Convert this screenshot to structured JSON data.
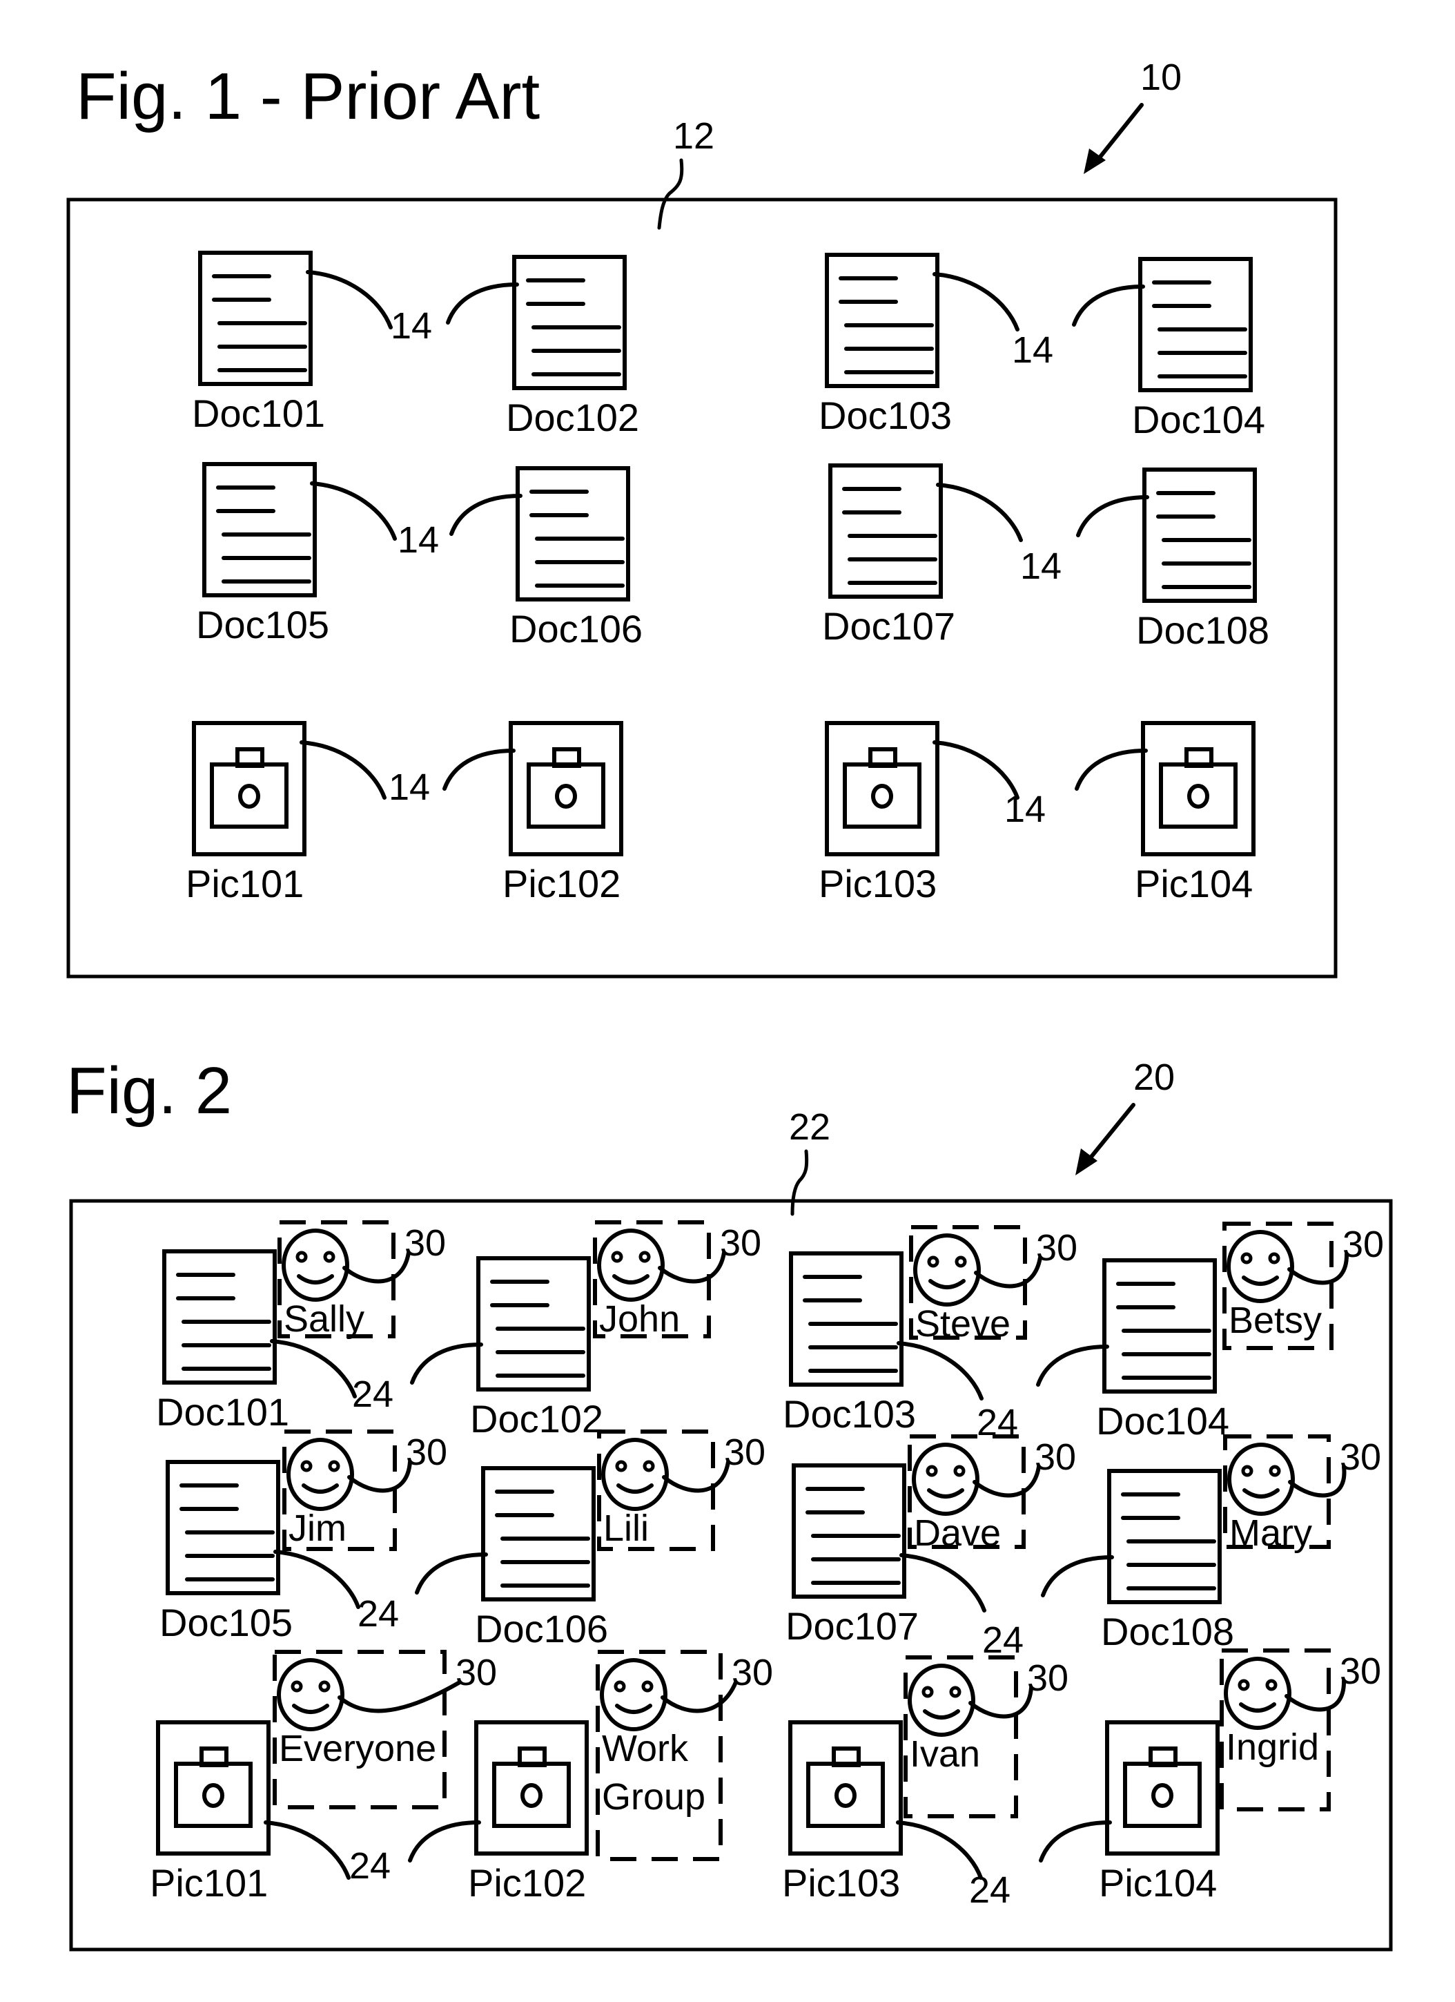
{
  "colors": {
    "ink": "#000000",
    "background": "#ffffff"
  },
  "fig1": {
    "title": "Fig. 1 - Prior Art",
    "ref_system": "10",
    "ref_area": "12",
    "link_ref": "14",
    "items": [
      {
        "label": "Doc101",
        "kind": "document"
      },
      {
        "label": "Doc102",
        "kind": "document"
      },
      {
        "label": "Doc103",
        "kind": "document"
      },
      {
        "label": "Doc104",
        "kind": "document"
      },
      {
        "label": "Doc105",
        "kind": "document"
      },
      {
        "label": "Doc106",
        "kind": "document"
      },
      {
        "label": "Doc107",
        "kind": "document"
      },
      {
        "label": "Doc108",
        "kind": "document"
      },
      {
        "label": "Pic101",
        "kind": "picture"
      },
      {
        "label": "Pic102",
        "kind": "picture"
      },
      {
        "label": "Pic103",
        "kind": "picture"
      },
      {
        "label": "Pic104",
        "kind": "picture"
      }
    ],
    "links": [
      {
        "from": "Doc101",
        "to": "Doc102",
        "ref": "14"
      },
      {
        "from": "Doc103",
        "to": "Doc104",
        "ref": "14"
      },
      {
        "from": "Doc105",
        "to": "Doc106",
        "ref": "14"
      },
      {
        "from": "Doc107",
        "to": "Doc108",
        "ref": "14"
      },
      {
        "from": "Pic101",
        "to": "Pic102",
        "ref": "14"
      },
      {
        "from": "Pic103",
        "to": "Pic104",
        "ref": "14"
      }
    ]
  },
  "fig2": {
    "title": "Fig. 2",
    "ref_system": "20",
    "ref_area": "22",
    "link_ref": "24",
    "owner_ref": "30",
    "items": [
      {
        "label": "Doc101",
        "kind": "document",
        "owner": [
          "Sally"
        ]
      },
      {
        "label": "Doc102",
        "kind": "document",
        "owner": [
          "John"
        ]
      },
      {
        "label": "Doc103",
        "kind": "document",
        "owner": [
          "Steve"
        ]
      },
      {
        "label": "Doc104",
        "kind": "document",
        "owner": [
          "Betsy"
        ]
      },
      {
        "label": "Doc105",
        "kind": "document",
        "owner": [
          "Jim"
        ]
      },
      {
        "label": "Doc106",
        "kind": "document",
        "owner": [
          "Lili"
        ]
      },
      {
        "label": "Doc107",
        "kind": "document",
        "owner": [
          "Dave"
        ]
      },
      {
        "label": "Doc108",
        "kind": "document",
        "owner": [
          "Mary"
        ]
      },
      {
        "label": "Pic101",
        "kind": "picture",
        "owner": [
          "Everyone"
        ]
      },
      {
        "label": "Pic102",
        "kind": "picture",
        "owner": [
          "Work",
          "Group"
        ]
      },
      {
        "label": "Pic103",
        "kind": "picture",
        "owner": [
          "Ivan"
        ]
      },
      {
        "label": "Pic104",
        "kind": "picture",
        "owner": [
          "Ingrid"
        ]
      }
    ],
    "links": [
      {
        "from": "Doc101",
        "to": "Doc102",
        "ref": "24"
      },
      {
        "from": "Doc103",
        "to": "Doc104",
        "ref": "24"
      },
      {
        "from": "Doc105",
        "to": "Doc106",
        "ref": "24"
      },
      {
        "from": "Doc107",
        "to": "Doc108",
        "ref": "24"
      },
      {
        "from": "Pic101",
        "to": "Pic102",
        "ref": "24"
      },
      {
        "from": "Pic103",
        "to": "Pic104",
        "ref": "24"
      }
    ]
  }
}
